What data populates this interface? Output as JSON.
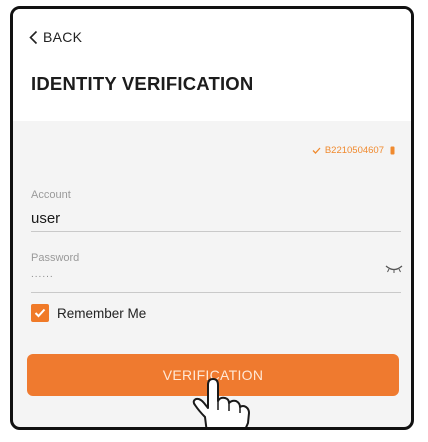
{
  "header": {
    "back_label": "BACK",
    "title": "IDENTITY VERIFICATION"
  },
  "device": {
    "serial": "B2210504607",
    "check_icon": "checkmark-icon",
    "status_icon": "device-status-icon"
  },
  "account": {
    "label": "Account",
    "value": "user"
  },
  "password": {
    "label": "Password",
    "masked_value": "......",
    "toggle_icon": "eye-closed-icon"
  },
  "remember_me": {
    "label": "Remember Me",
    "checked": true
  },
  "verify_button": {
    "label": "VERIFICATION"
  },
  "colors": {
    "accent": "#ef7a2f",
    "background": "#f4f4f4",
    "header": "#ffffff"
  }
}
